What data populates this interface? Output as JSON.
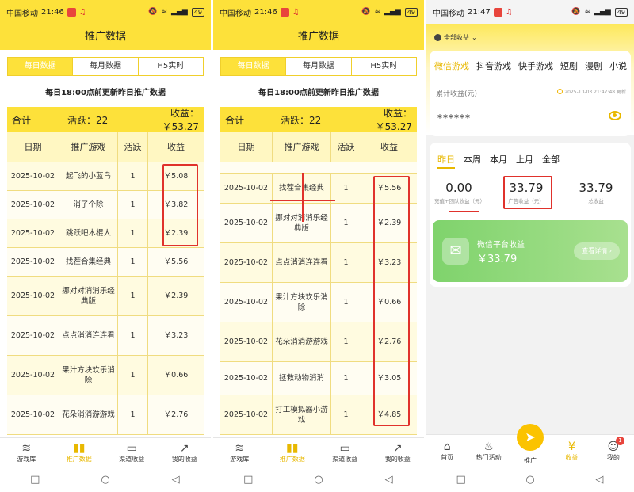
{
  "colors": {
    "brand_yellow": "#fde13a",
    "accent_gold": "#e8b800",
    "highlight_red": "#e0322c",
    "wechat_green": "#8fd97a"
  },
  "status_bars": [
    {
      "carrier": "中国移动",
      "time": "21:46",
      "battery": "49"
    },
    {
      "carrier": "中国移动",
      "time": "21:46",
      "battery": "49"
    },
    {
      "carrier": "中国移动",
      "time": "21:47",
      "battery": "49"
    }
  ],
  "promo_screen": {
    "title": "推广数据",
    "tabs": [
      {
        "label": "每日数据",
        "active": true
      },
      {
        "label": "每月数据",
        "active": false
      },
      {
        "label": "H5实时",
        "active": false
      }
    ],
    "notice": "每日18:00点前更新昨日推广数据",
    "summary": {
      "total_label": "合计",
      "active": "活跃：22",
      "income": "收益：￥53.27"
    },
    "headers": [
      "日期",
      "推广游戏",
      "活跃",
      "收益"
    ]
  },
  "screen1_rows": [
    {
      "date": "2025-10-02",
      "game": "起飞的小蓝鸟",
      "active": "1",
      "income": "￥5.08"
    },
    {
      "date": "2025-10-02",
      "game": "消了个除",
      "active": "1",
      "income": "￥3.82"
    },
    {
      "date": "2025-10-02",
      "game": "跳跃吧木棍人",
      "active": "1",
      "income": "￥2.39"
    },
    {
      "date": "2025-10-02",
      "game": "找茬合集经典",
      "active": "1",
      "income": "￥5.56"
    },
    {
      "date": "2025-10-02",
      "game": "挪对对消消乐经典版",
      "active": "1",
      "income": "￥2.39"
    },
    {
      "date": "2025-10-02",
      "game": "点点消消连连看",
      "active": "1",
      "income": "￥3.23"
    },
    {
      "date": "2025-10-02",
      "game": "果汁方块欢乐消除",
      "active": "1",
      "income": "￥0.66"
    },
    {
      "date": "2025-10-02",
      "game": "花朵消消游游戏",
      "active": "1",
      "income": "￥2.76"
    }
  ],
  "screen2_rows": [
    {
      "date": "2025-10-02",
      "game": "找茬合集经典",
      "active": "1",
      "income": "￥5.56"
    },
    {
      "date": "2025-10-02",
      "game": "挪对对消消乐经典版",
      "active": "1",
      "income": "￥2.39"
    },
    {
      "date": "2025-10-02",
      "game": "点点消消连连看",
      "active": "1",
      "income": "￥3.23"
    },
    {
      "date": "2025-10-02",
      "game": "果汁方块欢乐消除",
      "active": "1",
      "income": "￥0.66"
    },
    {
      "date": "2025-10-02",
      "game": "花朵消消游游戏",
      "active": "1",
      "income": "￥2.76"
    },
    {
      "date": "2025-10-02",
      "game": "拯救动物消消",
      "active": "1",
      "income": "￥3.05"
    },
    {
      "date": "2025-10-02",
      "game": "打工模拟器小游戏",
      "active": "1",
      "income": "￥4.85"
    }
  ],
  "bottom_nav": [
    {
      "label": "游戏库",
      "icon": "layers-icon",
      "active": false
    },
    {
      "label": "推广数据",
      "icon": "bar-chart-icon",
      "active": true
    },
    {
      "label": "渠道收益",
      "icon": "folder-icon",
      "active": false
    },
    {
      "label": "我的收益",
      "icon": "trend-icon",
      "active": false
    }
  ],
  "earnings_screen": {
    "dropdown": "全部收益",
    "categories": [
      {
        "label": "微信游戏",
        "active": true
      },
      {
        "label": "抖音游戏",
        "active": false
      },
      {
        "label": "快手游戏",
        "active": false
      },
      {
        "label": "短剧",
        "active": false
      },
      {
        "label": "漫剧",
        "active": false
      },
      {
        "label": "小说",
        "active": false
      }
    ],
    "cumulative_label": "累计收益(元)",
    "update_time": "2025-10-03 21:47:48 更新",
    "masked_value": "******",
    "periods": [
      {
        "label": "昨日",
        "active": true
      },
      {
        "label": "本周",
        "active": false
      },
      {
        "label": "本月",
        "active": false
      },
      {
        "label": "上月",
        "active": false
      },
      {
        "label": "全部",
        "active": false
      }
    ],
    "stats": [
      {
        "value": "0.00",
        "label": "充值+团队收益（元）"
      },
      {
        "value": "33.79",
        "label": "广告收益（元）"
      },
      {
        "value": "33.79",
        "label": "总收益"
      }
    ],
    "wechat_card": {
      "title": "微信平台收益",
      "amount": "￥33.79",
      "button": "查看详情 ›"
    },
    "bottom_nav": [
      {
        "label": "首页",
        "icon": "home-icon"
      },
      {
        "label": "热门活动",
        "icon": "flame-icon"
      },
      {
        "label": "推广",
        "icon": "paper-plane-icon"
      },
      {
        "label": "收益",
        "icon": "money-bag-icon"
      },
      {
        "label": "我的",
        "icon": "user-icon",
        "badge": "1"
      }
    ]
  },
  "system_nav": {
    "square": "□",
    "circle": "○",
    "back": "◁"
  }
}
